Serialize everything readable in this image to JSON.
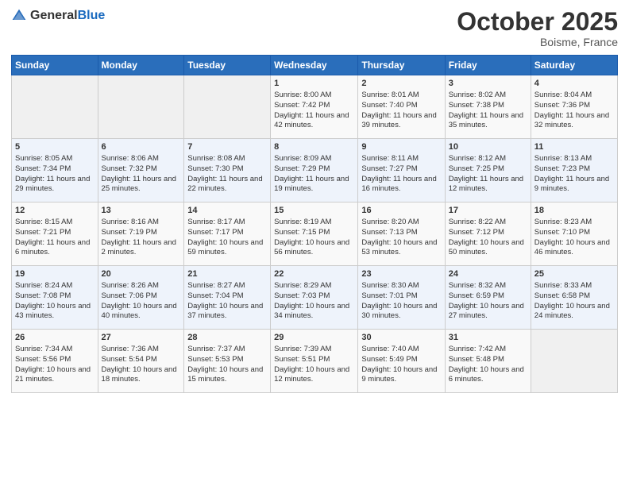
{
  "logo": {
    "general": "General",
    "blue": "Blue"
  },
  "title": "October 2025",
  "location": "Boisme, France",
  "days_of_week": [
    "Sunday",
    "Monday",
    "Tuesday",
    "Wednesday",
    "Thursday",
    "Friday",
    "Saturday"
  ],
  "weeks": [
    [
      {
        "day": "",
        "sunrise": "",
        "sunset": "",
        "daylight": ""
      },
      {
        "day": "",
        "sunrise": "",
        "sunset": "",
        "daylight": ""
      },
      {
        "day": "",
        "sunrise": "",
        "sunset": "",
        "daylight": ""
      },
      {
        "day": "1",
        "sunrise": "Sunrise: 8:00 AM",
        "sunset": "Sunset: 7:42 PM",
        "daylight": "Daylight: 11 hours and 42 minutes."
      },
      {
        "day": "2",
        "sunrise": "Sunrise: 8:01 AM",
        "sunset": "Sunset: 7:40 PM",
        "daylight": "Daylight: 11 hours and 39 minutes."
      },
      {
        "day": "3",
        "sunrise": "Sunrise: 8:02 AM",
        "sunset": "Sunset: 7:38 PM",
        "daylight": "Daylight: 11 hours and 35 minutes."
      },
      {
        "day": "4",
        "sunrise": "Sunrise: 8:04 AM",
        "sunset": "Sunset: 7:36 PM",
        "daylight": "Daylight: 11 hours and 32 minutes."
      }
    ],
    [
      {
        "day": "5",
        "sunrise": "Sunrise: 8:05 AM",
        "sunset": "Sunset: 7:34 PM",
        "daylight": "Daylight: 11 hours and 29 minutes."
      },
      {
        "day": "6",
        "sunrise": "Sunrise: 8:06 AM",
        "sunset": "Sunset: 7:32 PM",
        "daylight": "Daylight: 11 hours and 25 minutes."
      },
      {
        "day": "7",
        "sunrise": "Sunrise: 8:08 AM",
        "sunset": "Sunset: 7:30 PM",
        "daylight": "Daylight: 11 hours and 22 minutes."
      },
      {
        "day": "8",
        "sunrise": "Sunrise: 8:09 AM",
        "sunset": "Sunset: 7:29 PM",
        "daylight": "Daylight: 11 hours and 19 minutes."
      },
      {
        "day": "9",
        "sunrise": "Sunrise: 8:11 AM",
        "sunset": "Sunset: 7:27 PM",
        "daylight": "Daylight: 11 hours and 16 minutes."
      },
      {
        "day": "10",
        "sunrise": "Sunrise: 8:12 AM",
        "sunset": "Sunset: 7:25 PM",
        "daylight": "Daylight: 11 hours and 12 minutes."
      },
      {
        "day": "11",
        "sunrise": "Sunrise: 8:13 AM",
        "sunset": "Sunset: 7:23 PM",
        "daylight": "Daylight: 11 hours and 9 minutes."
      }
    ],
    [
      {
        "day": "12",
        "sunrise": "Sunrise: 8:15 AM",
        "sunset": "Sunset: 7:21 PM",
        "daylight": "Daylight: 11 hours and 6 minutes."
      },
      {
        "day": "13",
        "sunrise": "Sunrise: 8:16 AM",
        "sunset": "Sunset: 7:19 PM",
        "daylight": "Daylight: 11 hours and 2 minutes."
      },
      {
        "day": "14",
        "sunrise": "Sunrise: 8:17 AM",
        "sunset": "Sunset: 7:17 PM",
        "daylight": "Daylight: 10 hours and 59 minutes."
      },
      {
        "day": "15",
        "sunrise": "Sunrise: 8:19 AM",
        "sunset": "Sunset: 7:15 PM",
        "daylight": "Daylight: 10 hours and 56 minutes."
      },
      {
        "day": "16",
        "sunrise": "Sunrise: 8:20 AM",
        "sunset": "Sunset: 7:13 PM",
        "daylight": "Daylight: 10 hours and 53 minutes."
      },
      {
        "day": "17",
        "sunrise": "Sunrise: 8:22 AM",
        "sunset": "Sunset: 7:12 PM",
        "daylight": "Daylight: 10 hours and 50 minutes."
      },
      {
        "day": "18",
        "sunrise": "Sunrise: 8:23 AM",
        "sunset": "Sunset: 7:10 PM",
        "daylight": "Daylight: 10 hours and 46 minutes."
      }
    ],
    [
      {
        "day": "19",
        "sunrise": "Sunrise: 8:24 AM",
        "sunset": "Sunset: 7:08 PM",
        "daylight": "Daylight: 10 hours and 43 minutes."
      },
      {
        "day": "20",
        "sunrise": "Sunrise: 8:26 AM",
        "sunset": "Sunset: 7:06 PM",
        "daylight": "Daylight: 10 hours and 40 minutes."
      },
      {
        "day": "21",
        "sunrise": "Sunrise: 8:27 AM",
        "sunset": "Sunset: 7:04 PM",
        "daylight": "Daylight: 10 hours and 37 minutes."
      },
      {
        "day": "22",
        "sunrise": "Sunrise: 8:29 AM",
        "sunset": "Sunset: 7:03 PM",
        "daylight": "Daylight: 10 hours and 34 minutes."
      },
      {
        "day": "23",
        "sunrise": "Sunrise: 8:30 AM",
        "sunset": "Sunset: 7:01 PM",
        "daylight": "Daylight: 10 hours and 30 minutes."
      },
      {
        "day": "24",
        "sunrise": "Sunrise: 8:32 AM",
        "sunset": "Sunset: 6:59 PM",
        "daylight": "Daylight: 10 hours and 27 minutes."
      },
      {
        "day": "25",
        "sunrise": "Sunrise: 8:33 AM",
        "sunset": "Sunset: 6:58 PM",
        "daylight": "Daylight: 10 hours and 24 minutes."
      }
    ],
    [
      {
        "day": "26",
        "sunrise": "Sunrise: 7:34 AM",
        "sunset": "Sunset: 5:56 PM",
        "daylight": "Daylight: 10 hours and 21 minutes."
      },
      {
        "day": "27",
        "sunrise": "Sunrise: 7:36 AM",
        "sunset": "Sunset: 5:54 PM",
        "daylight": "Daylight: 10 hours and 18 minutes."
      },
      {
        "day": "28",
        "sunrise": "Sunrise: 7:37 AM",
        "sunset": "Sunset: 5:53 PM",
        "daylight": "Daylight: 10 hours and 15 minutes."
      },
      {
        "day": "29",
        "sunrise": "Sunrise: 7:39 AM",
        "sunset": "Sunset: 5:51 PM",
        "daylight": "Daylight: 10 hours and 12 minutes."
      },
      {
        "day": "30",
        "sunrise": "Sunrise: 7:40 AM",
        "sunset": "Sunset: 5:49 PM",
        "daylight": "Daylight: 10 hours and 9 minutes."
      },
      {
        "day": "31",
        "sunrise": "Sunrise: 7:42 AM",
        "sunset": "Sunset: 5:48 PM",
        "daylight": "Daylight: 10 hours and 6 minutes."
      },
      {
        "day": "",
        "sunrise": "",
        "sunset": "",
        "daylight": ""
      }
    ]
  ]
}
